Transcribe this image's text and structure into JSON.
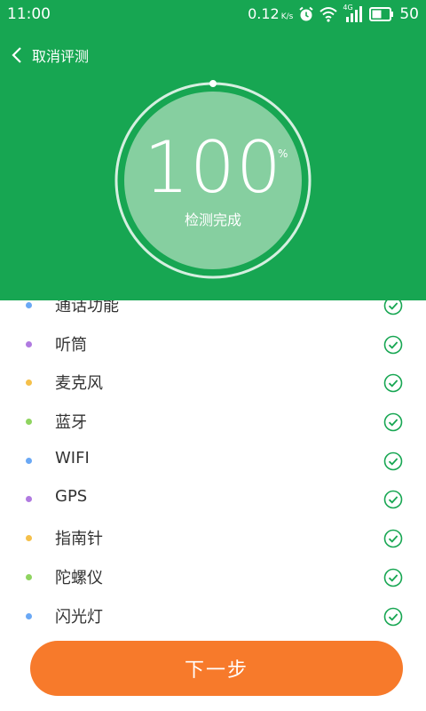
{
  "status_bar": {
    "time": "11:00",
    "net_speed": "0.12",
    "net_speed_unit": "K/s",
    "network_type": "4G",
    "battery": "50"
  },
  "header": {
    "back_label": "取消评测",
    "progress_value": "100",
    "progress_unit": "%",
    "progress_fraction": 1.0,
    "status_text": "检测完成"
  },
  "items": [
    {
      "label": "通话功能",
      "dot_color": "#6aa8f5"
    },
    {
      "label": "听筒",
      "dot_color": "#b07ae0"
    },
    {
      "label": "麦克风",
      "dot_color": "#f5c04a"
    },
    {
      "label": "蓝牙",
      "dot_color": "#8fd460"
    },
    {
      "label": "WIFI",
      "dot_color": "#6aa8f5"
    },
    {
      "label": "GPS",
      "dot_color": "#b07ae0"
    },
    {
      "label": "指南针",
      "dot_color": "#f5c04a"
    },
    {
      "label": "陀螺仪",
      "dot_color": "#8fd460"
    },
    {
      "label": "闪光灯",
      "dot_color": "#6aa8f5"
    }
  ],
  "footer": {
    "next_label": "下一步"
  },
  "colors": {
    "header_bg": "#17a652",
    "check": "#17a652",
    "button": "#f77a2b"
  },
  "icons": {
    "back": "chevron-left-icon",
    "check": "check-circle-icon",
    "alarm": "alarm-icon",
    "wifi": "wifi-icon",
    "signal": "signal-icon",
    "battery": "battery-icon"
  }
}
